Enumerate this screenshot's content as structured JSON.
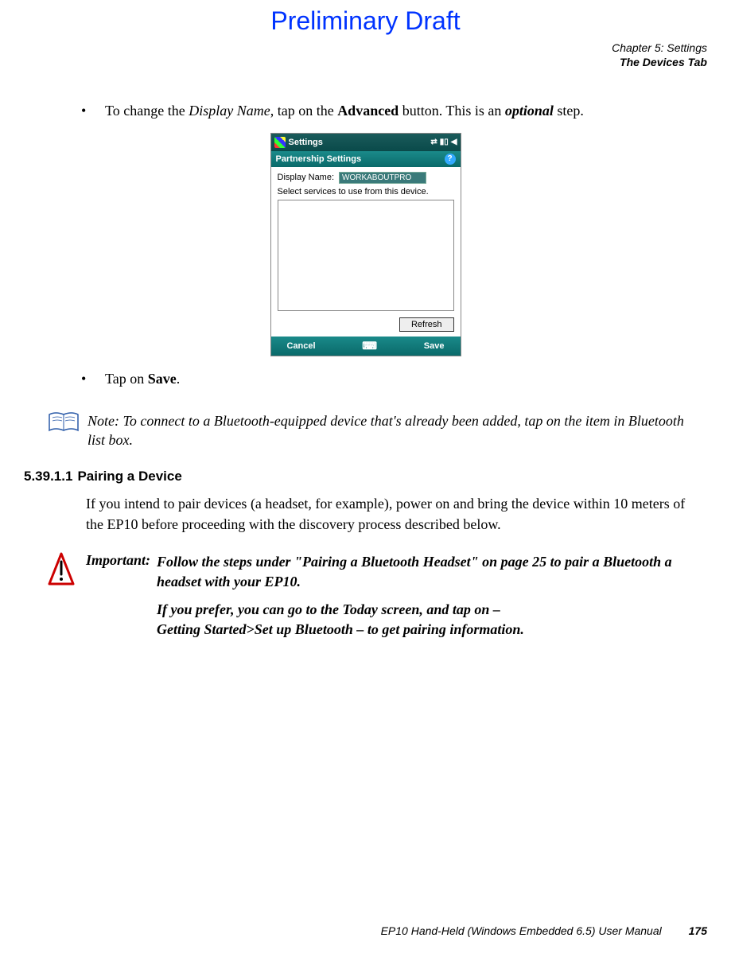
{
  "banner": "Preliminary Draft",
  "chapter": {
    "line1": "Chapter 5:  Settings",
    "line2": "The Devices Tab"
  },
  "instr1": {
    "pre": "To change the ",
    "em1": "Display Name",
    "mid": ", tap on the ",
    "bold1": "Advanced",
    "mid2": " button. This is an ",
    "em2": "optional",
    "post": " step."
  },
  "device": {
    "title": "Settings",
    "subtitle": "Partnership Settings",
    "displayNameLabel": "Display Name:",
    "displayNameValue": "WORKABOUTPRO",
    "servicesLabel": "Select services to use from this device.",
    "refresh": "Refresh",
    "cancel": "Cancel",
    "save": "Save"
  },
  "instr2": {
    "pre": "Tap on ",
    "bold": "Save",
    "post": "."
  },
  "note": {
    "label": "Note:",
    "text": " To connect to a Bluetooth-equipped device that's already been added, tap on the item in Bluetooth list box."
  },
  "subsection": {
    "number": "5.39.1.1",
    "title": "Pairing a Device",
    "body": "If you intend to pair devices (a headset, for example), power on and bring the device within 10 meters of the EP10 before proceeding with the discovery process described below."
  },
  "important": {
    "label": "Important:",
    "p1": "Follow the steps under \"Pairing a Bluetooth Headset\" on page 25 to pair a Bluetooth a headset with your EP10.",
    "p2a": "If you prefer, you can go to the Today screen, and tap on –",
    "p2b": "Getting Started>Set up Bluetooth – to get pairing information."
  },
  "footer": {
    "title": "EP10 Hand-Held (Windows Embedded 6.5) User Manual",
    "page": "175"
  }
}
